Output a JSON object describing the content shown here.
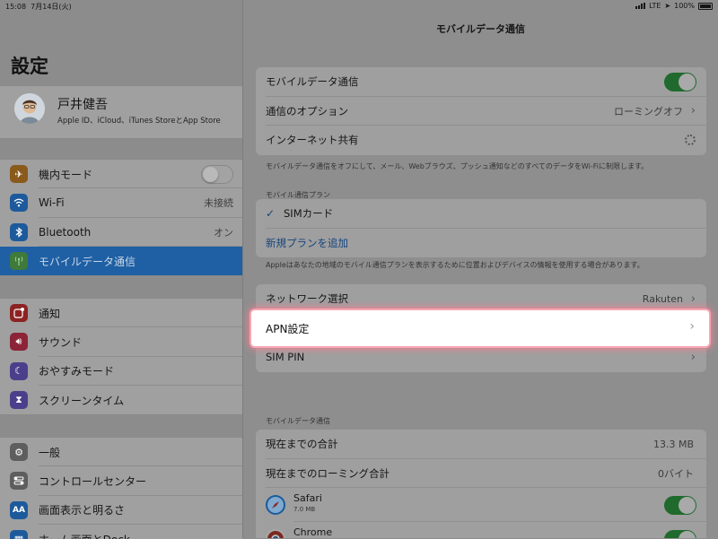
{
  "status": {
    "time": "15:08",
    "date": "7月14日(火)",
    "network": "LTE",
    "battery": "100%"
  },
  "sidebar": {
    "title": "設定",
    "profile": {
      "name": "戸井健吾",
      "subtitle": "Apple ID、iCloud、iTunes StoreとApp Store"
    },
    "group1": [
      {
        "label": "機内モード",
        "icon": "airplane-icon",
        "color": "#8a5a1c",
        "control": "toggle-off"
      },
      {
        "label": "Wi-Fi",
        "icon": "wifi-icon",
        "color": "#1d5a9c",
        "value": "未接続"
      },
      {
        "label": "Bluetooth",
        "icon": "bluetooth-icon",
        "color": "#1d5a9c",
        "value": "オン"
      },
      {
        "label": "モバイルデータ通信",
        "icon": "antenna-icon",
        "color": "#3f7a3a",
        "active": true
      }
    ],
    "group2": [
      {
        "label": "通知",
        "icon": "notification-icon",
        "color": "#8c2323"
      },
      {
        "label": "サウンド",
        "icon": "sound-icon",
        "color": "#8c2336"
      },
      {
        "label": "おやすみモード",
        "icon": "moon-icon",
        "color": "#4b3f8c"
      },
      {
        "label": "スクリーンタイム",
        "icon": "hourglass-icon",
        "color": "#4b3f8c"
      }
    ],
    "group3": [
      {
        "label": "一般",
        "icon": "gear-icon",
        "color": "#5e5e5e"
      },
      {
        "label": "コントロールセンター",
        "icon": "switches-icon",
        "color": "#5e5e5e"
      },
      {
        "label": "画面表示と明るさ",
        "icon": "text-size-icon",
        "color": "#1d5a9c",
        "glyph": "AA"
      },
      {
        "label": "ホーム画面とDock",
        "icon": "grid-icon",
        "color": "#1d5a9c"
      }
    ]
  },
  "main": {
    "title": "モバイルデータ通信",
    "card1": {
      "mobile_data": "モバイルデータ通信",
      "options_label": "通信のオプション",
      "options_value": "ローミングオフ",
      "hotspot_label": "インターネット共有"
    },
    "note1": "モバイルデータ通信をオフにして、メール、Webブラウズ、プッシュ通知などのすべてのデータをWi-Fiに制限します。",
    "plans_header": "モバイル通信プラン",
    "sim_card": "SIMカード",
    "add_plan": "新規プランを追加",
    "note2": "Appleはあなたの地域のモバイル通信プランを表示するために位置およびデバイスの情報を使用する場合があります。",
    "network_label": "ネットワーク選択",
    "network_value": "Rakuten",
    "apn_label": "APN設定",
    "sim_pin_label": "SIM PIN",
    "usage_header": "モバイルデータ通信",
    "current_total_label": "現在までの合計",
    "current_total_value": "13.3 MB",
    "roaming_total_label": "現在までのローミング合計",
    "roaming_total_value": "0バイト",
    "apps": [
      {
        "name": "Safari",
        "size": "7.0 MB",
        "icon": "safari-icon"
      },
      {
        "name": "Chrome",
        "size": "",
        "icon": "chrome-icon"
      }
    ]
  }
}
